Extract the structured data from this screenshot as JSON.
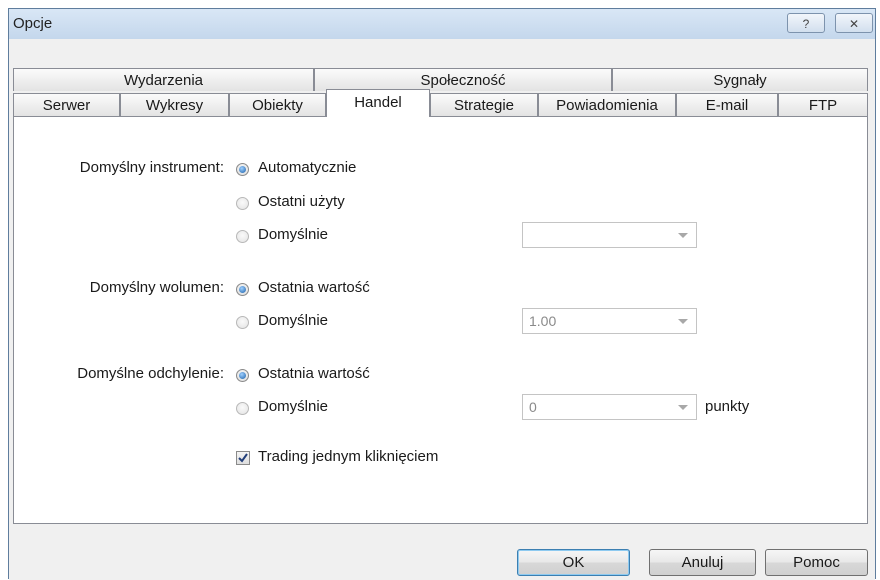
{
  "window": {
    "title": "Opcje",
    "help_label": "?",
    "close_label": "✕"
  },
  "tabs_row1": [
    {
      "label": "Wydarzenia"
    },
    {
      "label": "Społeczność"
    },
    {
      "label": "Sygnały"
    }
  ],
  "tabs_row2": [
    {
      "label": "Serwer"
    },
    {
      "label": "Wykresy"
    },
    {
      "label": "Obiekty"
    },
    {
      "label": "Handel",
      "active": true
    },
    {
      "label": "Strategie"
    },
    {
      "label": "Powiadomienia"
    },
    {
      "label": "E-mail"
    },
    {
      "label": "FTP"
    }
  ],
  "instrument": {
    "label": "Domyślny instrument:",
    "options": [
      "Automatycznie",
      "Ostatni użyty",
      "Domyślnie"
    ],
    "selected": "Automatycznie",
    "combo_value": ""
  },
  "volume": {
    "label": "Domyślny wolumen:",
    "options": [
      "Ostatnia wartość",
      "Domyślnie"
    ],
    "selected": "Ostatnia wartość",
    "combo_value": "1.00"
  },
  "deviation": {
    "label": "Domyślne odchylenie:",
    "options": [
      "Ostatnia wartość",
      "Domyślnie"
    ],
    "selected": "Ostatnia wartość",
    "combo_value": "0",
    "unit": "punkty"
  },
  "one_click": {
    "label": "Trading jednym kliknięciem",
    "checked": true
  },
  "buttons": {
    "ok": "OK",
    "cancel": "Anuluj",
    "help": "Pomoc"
  }
}
